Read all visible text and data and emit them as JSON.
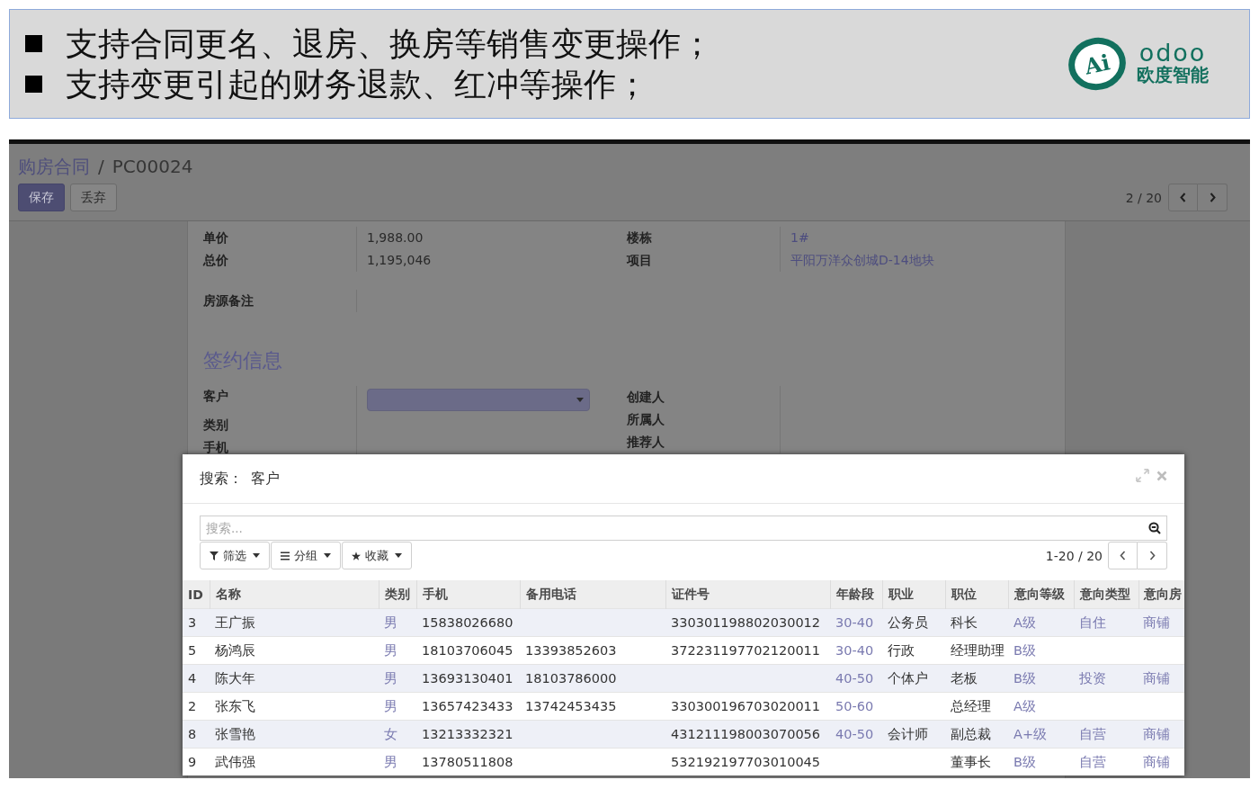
{
  "banner": {
    "bullets": [
      "支持合同更名、退房、换房等销售变更操作；",
      "支持变更引起的财务退款、红冲等操作；"
    ],
    "logo": {
      "mark": "Ai",
      "wordmark": "odoo",
      "name": "欧度智能"
    }
  },
  "control_panel": {
    "breadcrumb": [
      {
        "label": "购房合同",
        "kind": "link"
      },
      {
        "label": "PC00024",
        "kind": "current"
      }
    ],
    "separator": "/",
    "buttons": [
      {
        "label": "保存",
        "kind": "primary"
      },
      {
        "label": "丢弃",
        "kind": "secondary"
      }
    ],
    "pager": "2 / 20"
  },
  "form": {
    "groups": [
      [
        {
          "label": "单价",
          "kind": "text",
          "value": "1,988.00"
        },
        {
          "label": "总价",
          "kind": "text",
          "value": "1,195,046"
        }
      ],
      [
        {
          "label": "楼栋",
          "kind": "link",
          "value": "1#"
        },
        {
          "label": "项目",
          "kind": "link",
          "value": "平阳万洋众创城D-14地块"
        }
      ]
    ],
    "notes": [
      {
        "label": "房源备注"
      }
    ],
    "section": {
      "title": "签约信息",
      "groups": [
        [
          {
            "label": "客户",
            "kind": "select"
          },
          {
            "label": "类别"
          },
          {
            "label": "手机"
          }
        ],
        [
          {
            "label": "创建人"
          },
          {
            "label": "所属人"
          },
          {
            "label": "推荐人"
          }
        ]
      ]
    }
  },
  "dialog": {
    "title": "搜索：",
    "model": "客户",
    "search": {
      "placeholder": "搜索..."
    },
    "filters": [
      {
        "label": "筛选",
        "kind": "filter"
      },
      {
        "label": "分组",
        "kind": "group"
      },
      {
        "label": "收藏",
        "kind": "favorite"
      }
    ],
    "pager": "1-20 / 20",
    "table": {
      "columns": [
        {
          "label": "ID",
          "kind": "text"
        },
        {
          "label": "名称",
          "kind": "text"
        },
        {
          "label": "类别",
          "kind": "link"
        },
        {
          "label": "手机",
          "kind": "text"
        },
        {
          "label": "备用电话",
          "kind": "text"
        },
        {
          "label": "证件号",
          "kind": "text"
        },
        {
          "label": "年龄段",
          "kind": "link"
        },
        {
          "label": "职业",
          "kind": "text"
        },
        {
          "label": "职位",
          "kind": "text"
        },
        {
          "label": "意向等级",
          "kind": "link"
        },
        {
          "label": "意向类型",
          "kind": "link"
        },
        {
          "label": "意向房",
          "kind": "link"
        }
      ],
      "rows": [
        [
          "3",
          "王广振",
          "男",
          "15838026680",
          null,
          "330301198802030012",
          "30-40",
          "公务员",
          "科长",
          "A级",
          "自住",
          "商铺"
        ],
        [
          "5",
          "杨鸿辰",
          "男",
          "18103706045",
          "13393852603",
          "372231197702120011",
          "30-40",
          "行政",
          "经理助理",
          "B级",
          null,
          null
        ],
        [
          "4",
          "陈大年",
          "男",
          "13693130401",
          "18103786000",
          null,
          "40-50",
          "个体户",
          "老板",
          "B级",
          "投资",
          "商铺"
        ],
        [
          "2",
          "张东飞",
          "男",
          "13657423433",
          "13742453435",
          "330300196703020011",
          "50-60",
          null,
          "总经理",
          "A级",
          null,
          null
        ],
        [
          "8",
          "张雪艳",
          "女",
          "13213332321",
          null,
          "431211198003070056",
          "40-50",
          "会计师",
          "副总裁",
          "A+级",
          "自营",
          "商铺"
        ],
        [
          "9",
          "武伟强",
          "男",
          "13780511808",
          null,
          "532192197703010045",
          null,
          null,
          "董事长",
          "B级",
          "自营",
          "商铺"
        ]
      ]
    }
  }
}
